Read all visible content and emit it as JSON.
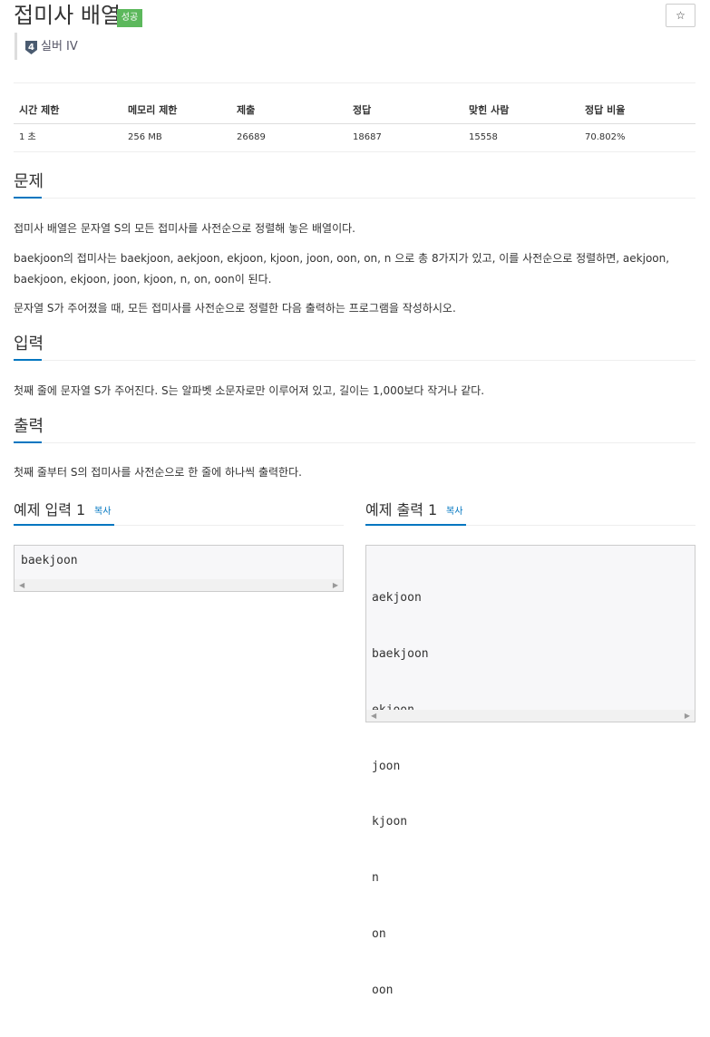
{
  "problem": {
    "title": "접미사 배열",
    "status_badge": "성공",
    "star_icon": "star-icon",
    "tier_number": "4",
    "tier_label": "실버 IV"
  },
  "info_table": {
    "headers": [
      "시간 제한",
      "메모리 제한",
      "제출",
      "정답",
      "맞힌 사람",
      "정답 비율"
    ],
    "values": [
      "1 초",
      "256 MB",
      "26689",
      "18687",
      "15558",
      "70.802%"
    ]
  },
  "sections": {
    "description": {
      "title": "문제",
      "paragraphs": [
        "접미사 배열은 문자열 S의 모든 접미사를 사전순으로 정렬해 놓은 배열이다.",
        "baekjoon의 접미사는 baekjoon, aekjoon, ekjoon, kjoon, joon, oon, on, n 으로 총 8가지가 있고, 이를 사전순으로 정렬하면, aekjoon,",
        "baekjoon, ekjoon, joon, kjoon, n, on, oon이 된다.",
        "문자열 S가 주어졌을 때, 모든 접미사를 사전순으로 정렬한 다음 출력하는 프로그램을 작성하시오."
      ]
    },
    "input": {
      "title": "입력",
      "text": "첫째 줄에 문자열 S가 주어진다. S는 알파벳 소문자로만 이루어져 있고, 길이는 1,000보다 작거나 같다."
    },
    "output": {
      "title": "출력",
      "text": "첫째 줄부터 S의 접미사를 사전순으로 한 줄에 하나씩 출력한다."
    }
  },
  "examples": {
    "input_title": "예제 입력 1",
    "output_title": "예제 출력 1",
    "copy_label": "복사",
    "input_text": "baekjoon",
    "output_lines": [
      "aekjoon",
      "baekjoon",
      "ekjoon",
      "joon",
      "kjoon",
      "n",
      "on",
      "oon"
    ]
  },
  "colors": {
    "accent": "#0076c0",
    "success": "#5cb85c"
  }
}
